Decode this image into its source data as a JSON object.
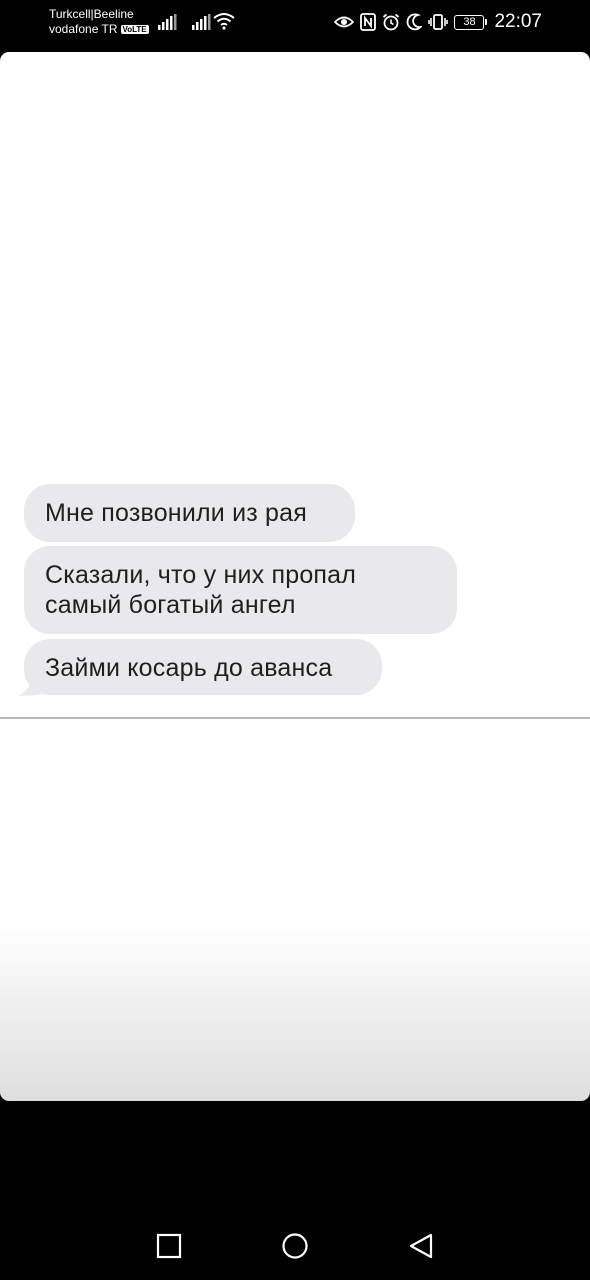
{
  "status_bar": {
    "carrier_1": "Turkcell|Beeline",
    "carrier_2": "vodafone TR",
    "volte_badge": "VoLTE",
    "battery_level": "38",
    "time": "22:07",
    "icons": [
      "signal-icon",
      "signal-icon",
      "wifi-icon",
      "eye-icon",
      "nfc-icon",
      "alarm-icon",
      "moon-icon",
      "vibrate-icon",
      "battery-icon"
    ]
  },
  "messages": [
    {
      "lines": [
        "Мне позвонили из рая"
      ]
    },
    {
      "lines": [
        "Сказали, что у них пропал",
        "самый богатый ангел"
      ]
    },
    {
      "lines": [
        "Займи косарь до аванса"
      ]
    }
  ],
  "nav_bar": {
    "icons": [
      "recent-apps-icon",
      "home-icon",
      "back-icon"
    ]
  },
  "colors": {
    "bubble": "#e9e9eb",
    "text": "#1f1f1f",
    "background": "#000000"
  }
}
